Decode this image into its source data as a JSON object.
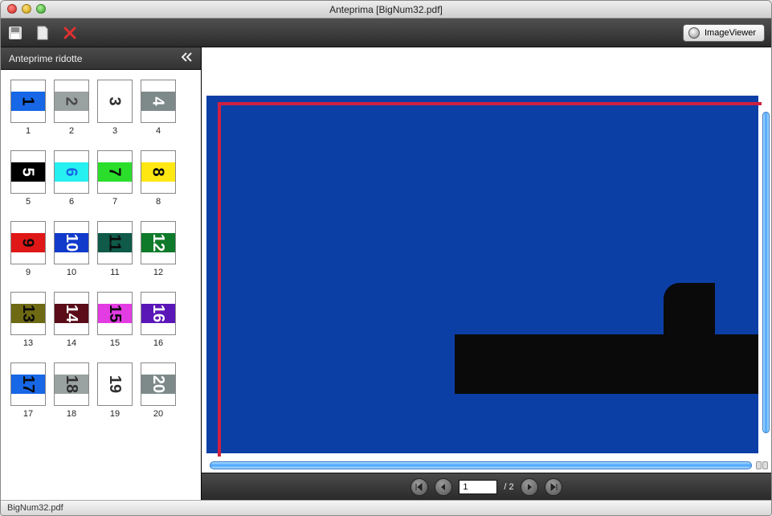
{
  "window": {
    "title": "Anteprima [BigNum32.pdf]"
  },
  "toolbar": {
    "imageviewer_label": "ImageViewer"
  },
  "sidebar": {
    "title": "Anteprime ridotte",
    "thumbnails": [
      {
        "label": "1",
        "num": "1",
        "bg": "#1767e6",
        "fg": "#000000"
      },
      {
        "label": "2",
        "num": "2",
        "bg": "#9aa1a1",
        "fg": "#4a4a4a"
      },
      {
        "label": "3",
        "num": "3",
        "bg": "#ffffff",
        "fg": "#2f2f2f"
      },
      {
        "label": "4",
        "num": "4",
        "bg": "#7e8a8a",
        "fg": "#ffffff"
      },
      {
        "label": "5",
        "num": "5",
        "bg": "#000000",
        "fg": "#ffffff"
      },
      {
        "label": "6",
        "num": "6",
        "bg": "#27f0f0",
        "fg": "#1767e6"
      },
      {
        "label": "7",
        "num": "7",
        "bg": "#2bde2b",
        "fg": "#0a0a0a"
      },
      {
        "label": "8",
        "num": "8",
        "bg": "#ffe712",
        "fg": "#0a0a0a"
      },
      {
        "label": "9",
        "num": "9",
        "bg": "#e01717",
        "fg": "#0a0a0a"
      },
      {
        "label": "10",
        "num": "10",
        "bg": "#123acb",
        "fg": "#ffffff"
      },
      {
        "label": "11",
        "num": "11",
        "bg": "#0f5a49",
        "fg": "#0a0a0a"
      },
      {
        "label": "12",
        "num": "12",
        "bg": "#0f7a2a",
        "fg": "#ffffff"
      },
      {
        "label": "13",
        "num": "13",
        "bg": "#6e6a14",
        "fg": "#0a0a0a"
      },
      {
        "label": "14",
        "num": "14",
        "bg": "#5a0c18",
        "fg": "#ffffff"
      },
      {
        "label": "15",
        "num": "15",
        "bg": "#e23ce2",
        "fg": "#0a0a0a"
      },
      {
        "label": "16",
        "num": "16",
        "bg": "#5b16b8",
        "fg": "#ffffff"
      },
      {
        "label": "17",
        "num": "17",
        "bg": "#1767e6",
        "fg": "#0a0a0a"
      },
      {
        "label": "18",
        "num": "18",
        "bg": "#9aa1a1",
        "fg": "#2f2f2f"
      },
      {
        "label": "19",
        "num": "19",
        "bg": "#ffffff",
        "fg": "#2f2f2f"
      },
      {
        "label": "20",
        "num": "20",
        "bg": "#7e8a8a",
        "fg": "#ffffff"
      }
    ]
  },
  "pager": {
    "current": "1",
    "total_label": "/ 2"
  },
  "status": {
    "filename": "BigNum32.pdf"
  }
}
